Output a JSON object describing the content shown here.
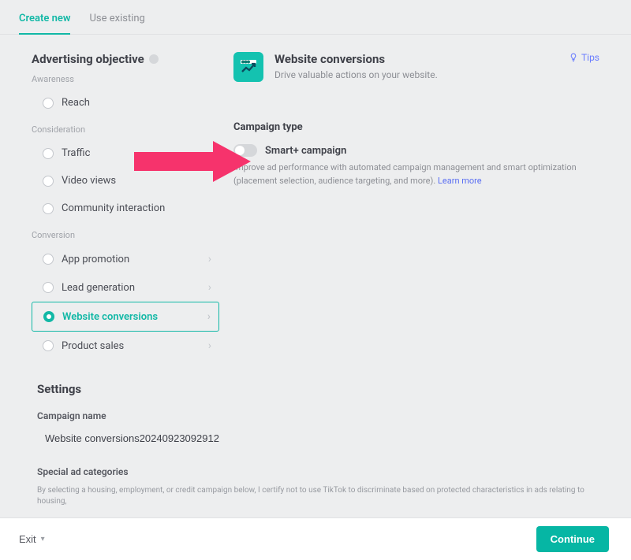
{
  "tabs": {
    "create": "Create new",
    "use": "Use existing"
  },
  "sidebar": {
    "title": "Advertising objective",
    "groups": [
      {
        "label": "Awareness",
        "items": [
          "Reach"
        ]
      },
      {
        "label": "Consideration",
        "items": [
          "Traffic",
          "Video views",
          "Community interaction"
        ]
      },
      {
        "label": "Conversion",
        "items": [
          "App promotion",
          "Lead generation",
          "Website conversions",
          "Product sales"
        ]
      }
    ],
    "selected": "Website conversions"
  },
  "objective_panel": {
    "title": "Website conversions",
    "subtitle": "Drive valuable actions on your website.",
    "tips_label": "Tips"
  },
  "campaign_type": {
    "heading": "Campaign type",
    "toggle_label": "Smart+ campaign",
    "desc": "Improve ad performance with automated campaign management and smart optimization (placement selection, audience targeting, and more).",
    "learn_more": "Learn more"
  },
  "settings": {
    "heading": "Settings",
    "campaign_name_label": "Campaign name",
    "campaign_name_value": "Website conversions20240923092912",
    "special_cat_label": "Special ad categories",
    "special_cat_desc": "By selecting a housing, employment, or credit campaign below, I certify not to use TikTok to discriminate based on protected characteristics in ads relating to housing,"
  },
  "footer": {
    "exit": "Exit",
    "continue": "Continue"
  }
}
